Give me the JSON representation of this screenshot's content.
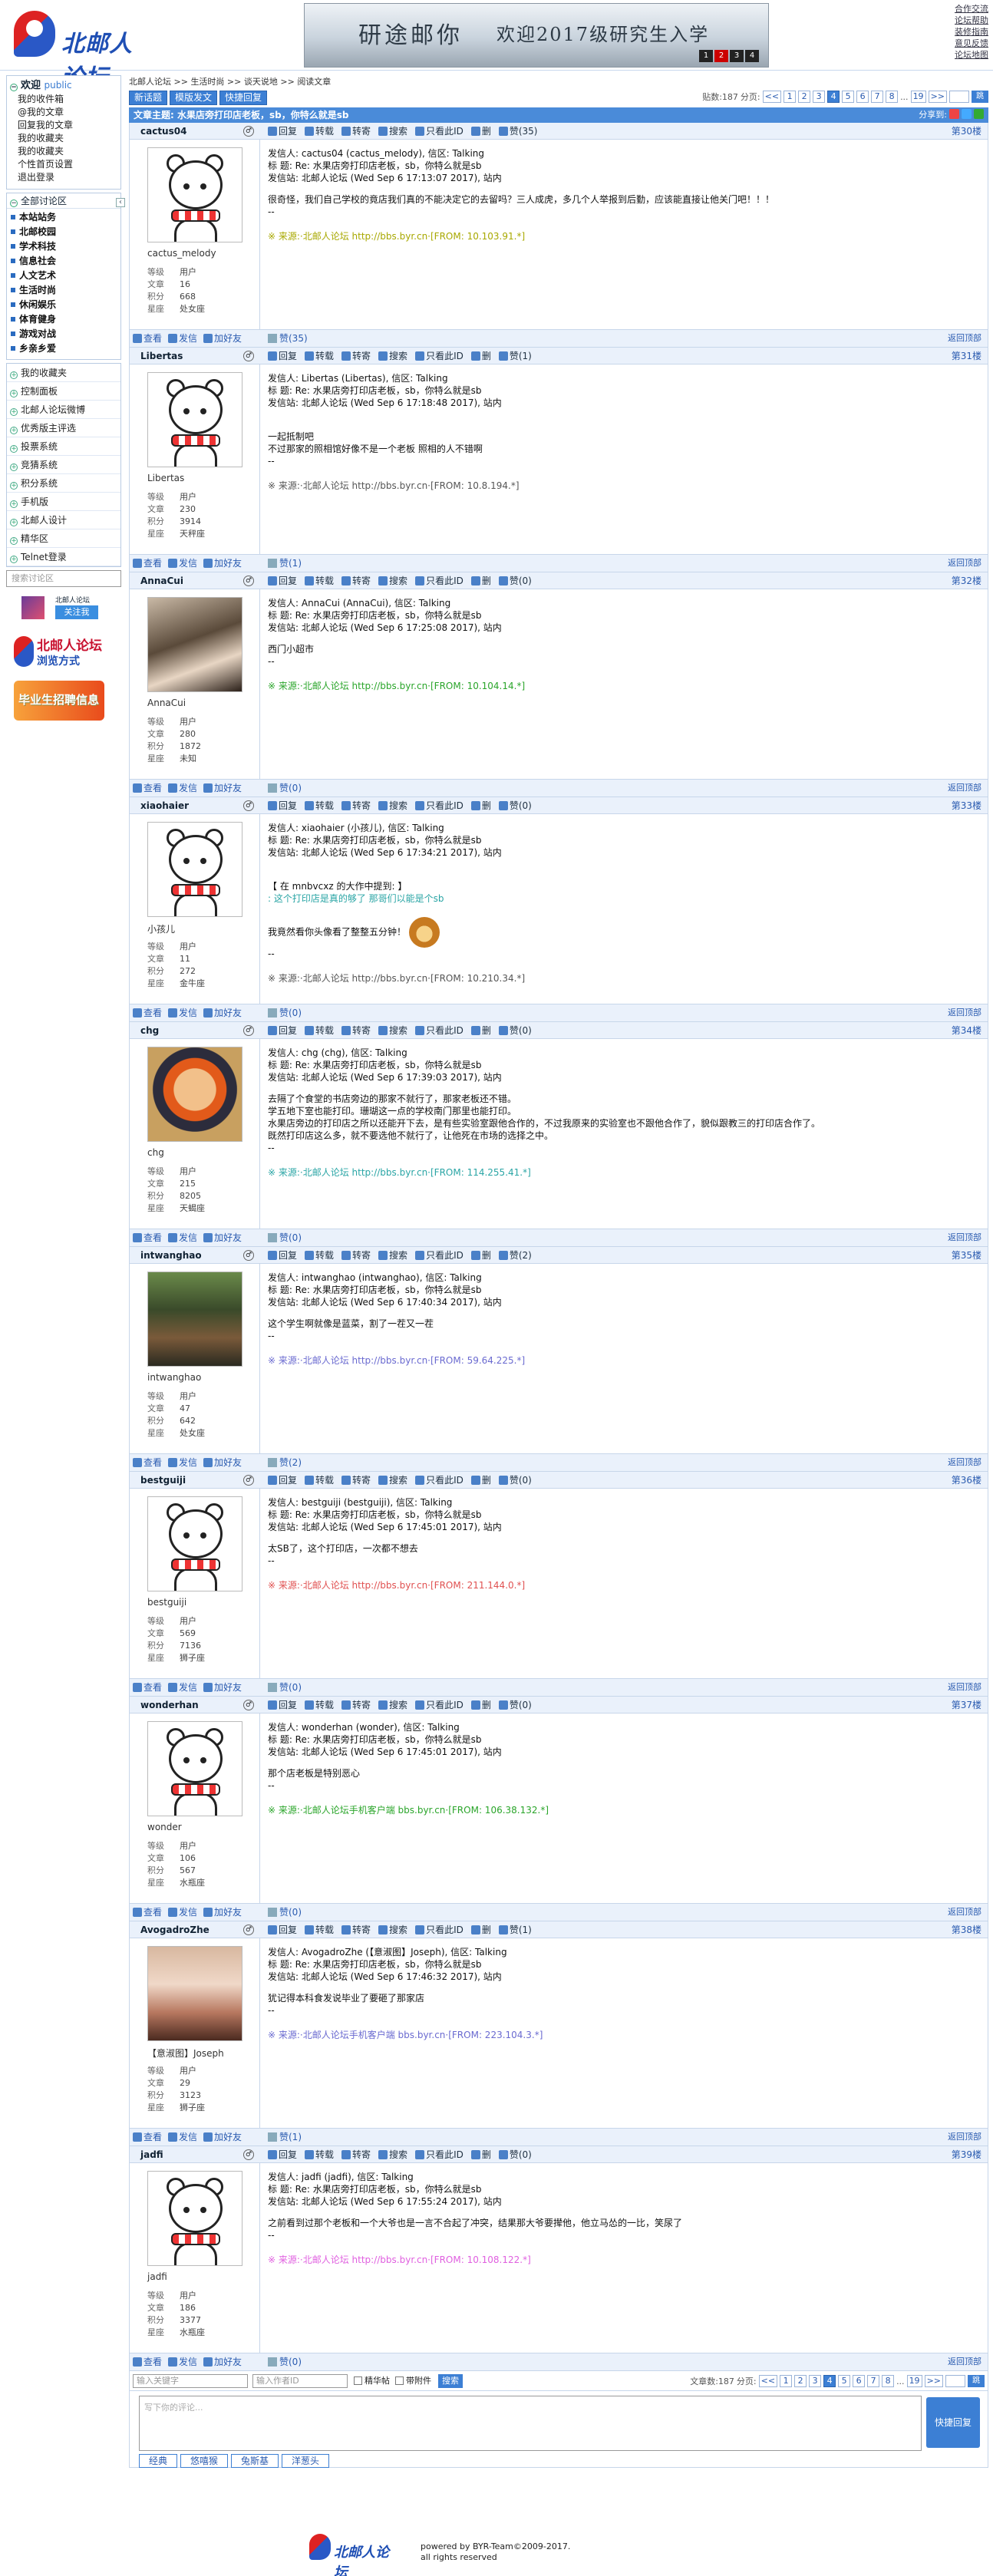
{
  "site": {
    "logo_text": "北邮人论坛",
    "toplinks": [
      "合作交流",
      "论坛帮助",
      "装修指南",
      "意见反馈",
      "论坛地图"
    ]
  },
  "banner": {
    "text1": "研途邮你",
    "text2": "欢迎2017级研究生入学",
    "dots": [
      "1",
      "2",
      "3",
      "4"
    ]
  },
  "sidebar": {
    "welcome": "欢迎",
    "user": "public",
    "user_links": [
      "我的收件箱",
      "@我的文章",
      "回复我的文章",
      "我的收藏夹",
      "我的收藏夹",
      "个性首页设置",
      "退出登录"
    ],
    "all_boards": "全部讨论区",
    "categories": [
      "本站站务",
      "北邮校园",
      "学术科技",
      "信息社会",
      "人文艺术",
      "生活时尚",
      "休闲娱乐",
      "体育健身",
      "游戏对战",
      "乡亲乡爱"
    ],
    "nav_items": [
      "我的收藏夹",
      "控制面板",
      "北邮人论坛微博",
      "优秀版主评选",
      "投票系统",
      "竞猜系统",
      "积分系统",
      "手机版",
      "北邮人设计",
      "精华区",
      "Telnet登录"
    ],
    "search_placeholder": "搜索讨论区",
    "promo1_text": "北邮人论坛",
    "promo1_btn": "关注我",
    "promo2_text1": "北邮人论坛",
    "promo2_text2": "浏览方式",
    "promo3_text": "毕业生招聘信息"
  },
  "breadcrumb": [
    "北邮人论坛",
    "生活时尚",
    "谈天说地",
    "阅读文章"
  ],
  "toolbar": {
    "new_topic": "新话题",
    "template_post": "模版发文",
    "quick_reply": "快捷回复"
  },
  "pager": {
    "posts_label": "贴数:187",
    "page_label": "分页:",
    "prev": "<<",
    "pages": [
      "1",
      "2",
      "3",
      "4",
      "5",
      "6",
      "7",
      "8",
      "...",
      "19"
    ],
    "current": "4",
    "next": ">>",
    "go": "跳"
  },
  "subject": {
    "label": "文章主题:",
    "title": "水果店旁打印店老板，sb，你特么就是sb",
    "share": "分享到:"
  },
  "post_actions": [
    "回复",
    "转载",
    "转寄",
    "搜索",
    "只看此ID",
    "删"
  ],
  "foot_actions": [
    "查看",
    "发信",
    "加好友"
  ],
  "back_top": "返回顶部",
  "posts": [
    {
      "id": "cactus04",
      "nick": "cactus_melody",
      "floor": "第30楼",
      "likes": "赞(35)",
      "level": "用户",
      "articles": "16",
      "score": "668",
      "star": "处女座",
      "avatar": "bear",
      "meta": [
        "发信人: cactus04 (cactus_melody), 信区: Talking",
        "标  题: Re: 水果店旁打印店老板，sb，你特么就是sb",
        "发信站: 北邮人论坛 (Wed Sep  6 17:13:07 2017), 站内"
      ],
      "content": [
        "很奇怪，我们自己学校的竟店我们真的不能决定它的去留吗？三人成虎，多几个人举报到后勤，应该能直接让他关门吧！！！",
        "--"
      ],
      "src": "※ 来源:·北邮人论坛 http://bbs.byr.cn·[FROM: 10.103.91.*]",
      "src_color": "#a8a800"
    },
    {
      "id": "Libertas",
      "nick": "Libertas",
      "floor": "第31楼",
      "likes": "赞(1)",
      "level": "用户",
      "articles": "230",
      "score": "3914",
      "star": "天秤座",
      "avatar": "bear",
      "meta": [
        "发信人: Libertas (Libertas), 信区: Talking",
        "标  题: Re: 水果店旁打印店老板，sb，你特么就是sb",
        "发信站: 北邮人论坛 (Wed Sep  6 17:18:48 2017), 站内"
      ],
      "content": [
        "",
        "一起抵制吧",
        "不过那家的照相馆好像不是一个老板 照相的人不错啊",
        "--"
      ],
      "src": "※ 来源:·北邮人论坛 http://bbs.byr.cn·[FROM: 10.8.194.*]",
      "src_color": "#555555"
    },
    {
      "id": "AnnaCui",
      "nick": "AnnaCui",
      "floor": "第32楼",
      "likes": "赞(0)",
      "level": "用户",
      "articles": "280",
      "score": "1872",
      "star": "未知",
      "avatar": "photo1",
      "meta": [
        "发信人: AnnaCui (AnnaCui), 信区: Talking",
        "标  题: Re: 水果店旁打印店老板，sb，你特么就是sb",
        "发信站: 北邮人论坛 (Wed Sep  6 17:25:08 2017), 站内"
      ],
      "content": [
        "西门小超市",
        "--"
      ],
      "src": "※ 来源:·北邮人论坛 http://bbs.byr.cn·[FROM: 10.104.14.*]",
      "src_color": "#2aa52a"
    },
    {
      "id": "xiaohaier",
      "nick": "小孩儿",
      "floor": "第33楼",
      "likes": "赞(0)",
      "level": "用户",
      "articles": "11",
      "score": "272",
      "star": "金牛座",
      "avatar": "bear",
      "meta": [
        "发信人: xiaohaier (小孩儿), 信区: Talking",
        "标  题: Re: 水果店旁打印店老板，sb，你特么就是sb",
        "发信站: 北邮人论坛 (Wed Sep  6 17:34:21 2017), 站内"
      ],
      "content": [
        "",
        "【 在 mnbvcxz 的大作中提到: 】",
        ": 这个打印店是真的够了  那哥们以能是个sb",
        "",
        "我竟然看你头像看了整整五分钟！",
        "--"
      ],
      "src": "※ 来源:·北邮人论坛 http://bbs.byr.cn·[FROM: 10.210.34.*]",
      "src_color": "#555555"
    },
    {
      "id": "chg",
      "nick": "chg",
      "floor": "第34楼",
      "likes": "赞(0)",
      "level": "用户",
      "articles": "215",
      "score": "8205",
      "star": "天蝎座",
      "avatar": "photo2",
      "meta": [
        "发信人: chg (chg), 信区: Talking",
        "标  题: Re: 水果店旁打印店老板，sb，你特么就是sb",
        "发信站: 北邮人论坛 (Wed Sep  6 17:39:03 2017), 站内"
      ],
      "content": [
        "去隔了个食堂的书店旁边的那家不就行了，那家老板还不错。",
        "学五地下室也能打印。珊瑚这一点的学校南门那里也能打印。",
        "水果店旁边的打印店之所以还能开下去，是有些实验室跟他合作的，不过我原来的实验室也不跟他合作了，貌似跟教三的打印店合作了。",
        "既然打印店这么多，就不要选他不就行了，让他死在市场的选择之中。",
        "--"
      ],
      "src": "※ 来源:·北邮人论坛 http://bbs.byr.cn·[FROM: 114.255.41.*]",
      "src_color": "#2aa5a5"
    },
    {
      "id": "intwanghao",
      "nick": "intwanghao",
      "floor": "第35楼",
      "likes": "赞(2)",
      "level": "用户",
      "articles": "47",
      "score": "642",
      "star": "处女座",
      "avatar": "photo3",
      "meta": [
        "发信人: intwanghao (intwanghao), 信区: Talking",
        "标  题: Re: 水果店旁打印店老板，sb，你特么就是sb",
        "发信站: 北邮人论坛 (Wed Sep  6 17:40:34 2017), 站内"
      ],
      "content": [
        "这个学生啊就像是蓝菜，割了一茬又一茬",
        "--"
      ],
      "src": "※ 来源:·北邮人论坛 http://bbs.byr.cn·[FROM: 59.64.225.*]",
      "src_color": "#6a6ad0"
    },
    {
      "id": "bestguiji",
      "nick": "bestguiji",
      "floor": "第36楼",
      "likes": "赞(0)",
      "level": "用户",
      "articles": "569",
      "score": "7136",
      "star": "狮子座",
      "avatar": "bear",
      "meta": [
        "发信人: bestguiji (bestguiji), 信区: Talking",
        "标  题: Re: 水果店旁打印店老板，sb，你特么就是sb",
        "发信站: 北邮人论坛 (Wed Sep  6 17:45:01 2017), 站内"
      ],
      "content": [
        "太SB了，这个打印店，一次都不想去",
        "--"
      ],
      "src": "※ 来源:·北邮人论坛 http://bbs.byr.cn·[FROM: 211.144.0.*]",
      "src_color": "#e05050"
    },
    {
      "id": "wonderhan",
      "nick": "wonder",
      "floor": "第37楼",
      "likes": "赞(0)",
      "level": "用户",
      "articles": "106",
      "score": "567",
      "star": "水瓶座",
      "avatar": "bear",
      "meta": [
        "发信人: wonderhan (wonder), 信区: Talking",
        "标  题: Re: 水果店旁打印店老板，sb，你特么就是sb",
        "发信站: 北邮人论坛 (Wed Sep  6 17:45:01 2017), 站内"
      ],
      "content": [
        "那个店老板是特别恶心",
        "--"
      ],
      "src": "※ 来源:·北邮人论坛手机客户端 bbs.byr.cn·[FROM: 106.38.132.*]",
      "src_color": "#2aa52a"
    },
    {
      "id": "AvogadroZhe",
      "nick": "【意淑图】Joseph",
      "floor": "第38楼",
      "likes": "赞(1)",
      "level": "用户",
      "articles": "29",
      "score": "3123",
      "star": "狮子座",
      "avatar": "photo4",
      "meta": [
        "发信人: AvogadroZhe (【意淑图】Joseph), 信区: Talking",
        "标  题: Re: 水果店旁打印店老板，sb，你特么就是sb",
        "发信站: 北邮人论坛 (Wed Sep  6 17:46:32 2017), 站内"
      ],
      "content": [
        "犹记得本科食发说毕业了要砸了那家店",
        "--"
      ],
      "src": "※ 来源:·北邮人论坛手机客户端 bbs.byr.cn·[FROM: 223.104.3.*]",
      "src_color": "#6a6ad0"
    },
    {
      "id": "jadfi",
      "nick": "jadfi",
      "floor": "第39楼",
      "likes": "赞(0)",
      "level": "用户",
      "articles": "186",
      "score": "3377",
      "star": "水瓶座",
      "avatar": "bear",
      "meta": [
        "发信人: jadfi (jadfi), 信区: Talking",
        "标  题: Re: 水果店旁打印店老板，sb，你特么就是sb",
        "发信站: 北邮人论坛 (Wed Sep  6 17:55:24 2017), 站内"
      ],
      "content": [
        "之前看到过那个老板和一个大爷也是一言不合起了冲突，结果那大爷要撵他，他立马怂的一比，笑尿了",
        "--"
      ],
      "src": "※ 来源:·北邮人论坛 http://bbs.byr.cn·[FROM: 10.108.122.*]",
      "src_color": "#e060e0"
    }
  ],
  "stat_labels": {
    "level": "等级",
    "articles": "文章",
    "score": "积分",
    "star": "星座"
  },
  "bottom": {
    "keyword_placeholder": "输入关键字",
    "author_placeholder": "输入作者ID",
    "opt1": "精华帖",
    "opt2": "带附件",
    "search": "搜索",
    "posts_label": "文章数:187"
  },
  "reply": {
    "placeholder": "写下你的评论...",
    "submit": "快捷回复",
    "tags": [
      "经典",
      "悠嘻猴",
      "兔斯基",
      "洋葱头"
    ]
  },
  "footer": {
    "line1": "powered by BYR-Team©2009-2017.",
    "line2": "all rights reserved"
  }
}
